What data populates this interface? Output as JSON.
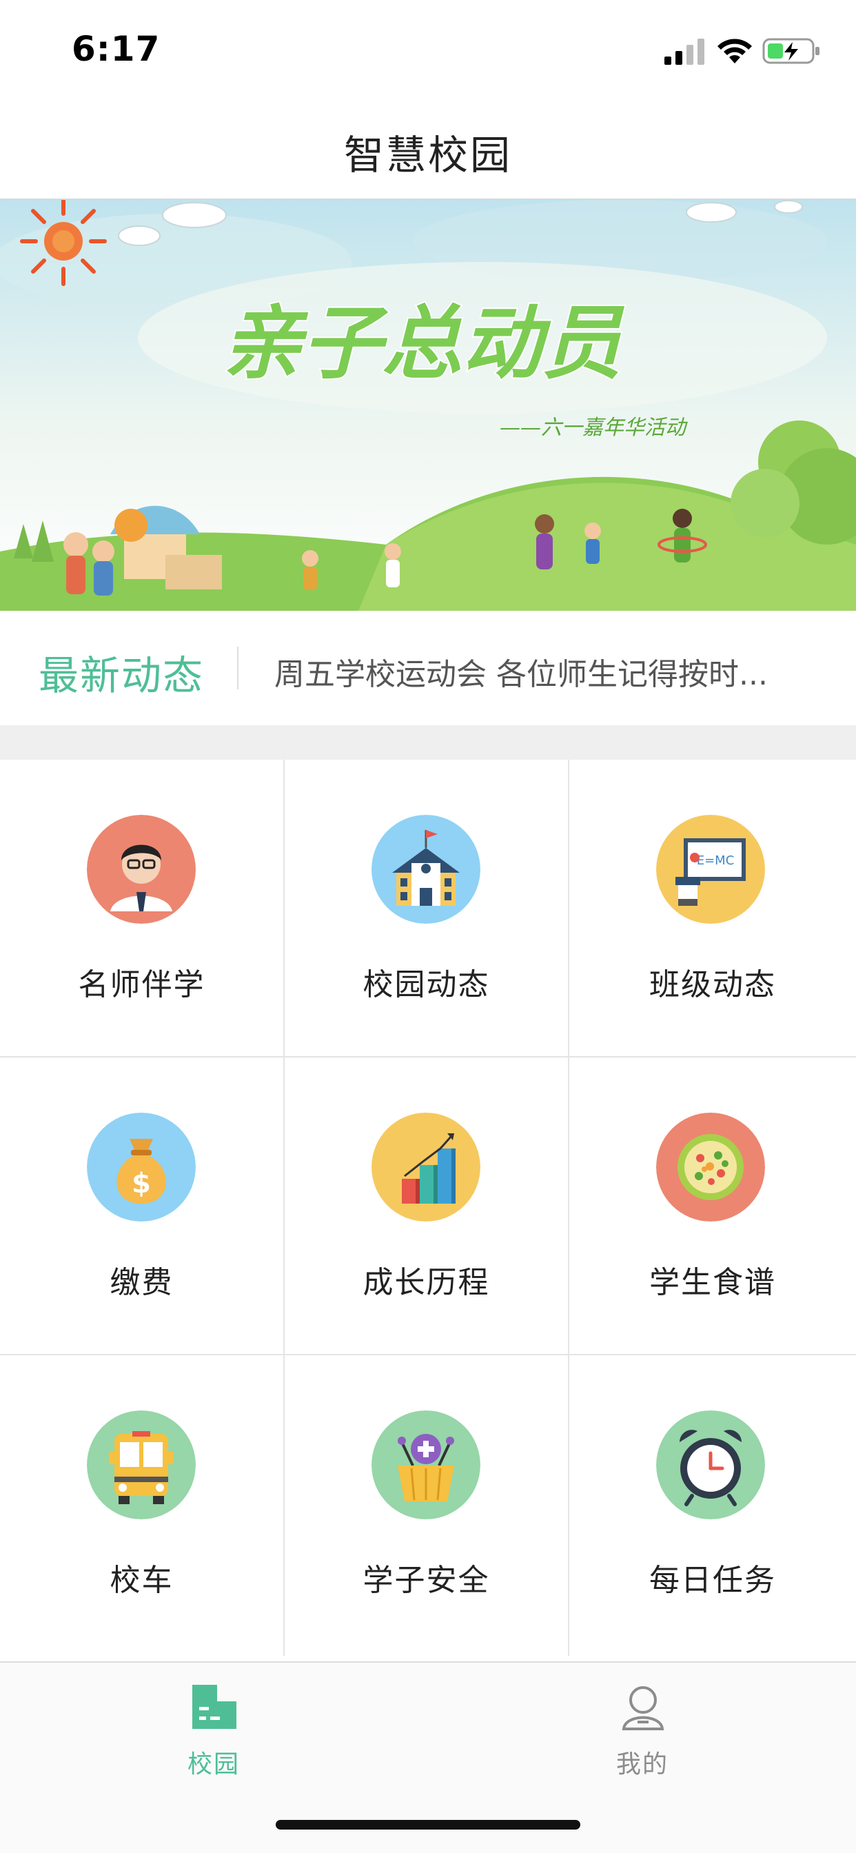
{
  "status": {
    "time": "6:17"
  },
  "header": {
    "title": "智慧校园"
  },
  "banner": {
    "headline": "亲子总动员",
    "subline": "——六一嘉年华活动",
    "active_slide": 1,
    "slide_count": 2
  },
  "news": {
    "title": "最新动态",
    "text": "周五学校运动会 各位师生记得按时..."
  },
  "grid": {
    "items": [
      {
        "label": "名师伴学",
        "icon": "teacher-icon",
        "bg": "#ec8670"
      },
      {
        "label": "校园动态",
        "icon": "school-icon",
        "bg": "#8fd2f5"
      },
      {
        "label": "班级动态",
        "icon": "classroom-icon",
        "bg": "#f6c95f"
      },
      {
        "label": "缴费",
        "icon": "money-bag-icon",
        "bg": "#8fd2f5"
      },
      {
        "label": "成长历程",
        "icon": "growth-chart-icon",
        "bg": "#f6c95f"
      },
      {
        "label": "学生食谱",
        "icon": "food-plate-icon",
        "bg": "#ec8670"
      },
      {
        "label": "校车",
        "icon": "school-bus-icon",
        "bg": "#96d6a8"
      },
      {
        "label": "学子安全",
        "icon": "safety-basket-icon",
        "bg": "#96d6a8"
      },
      {
        "label": "每日任务",
        "icon": "alarm-clock-icon",
        "bg": "#96d6a8"
      }
    ]
  },
  "tabbar": {
    "tabs": [
      {
        "label": "校园",
        "icon": "campus-tab-icon",
        "active": true
      },
      {
        "label": "我的",
        "icon": "profile-tab-icon",
        "active": false
      }
    ]
  },
  "colors": {
    "accent": "#4fbe97",
    "inactive": "#8c8c8c"
  }
}
